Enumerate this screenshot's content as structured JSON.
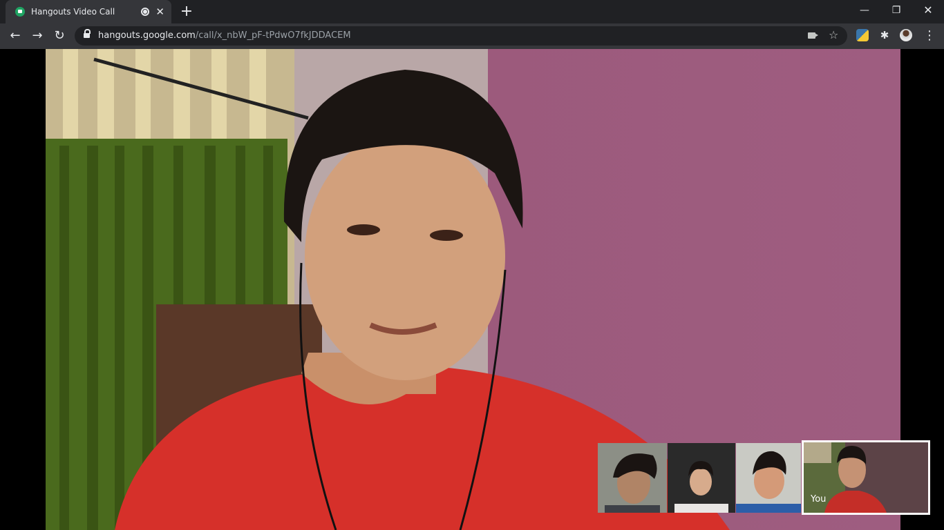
{
  "browser": {
    "tab": {
      "title": "Hangouts Video Call"
    },
    "address_bar": {
      "host": "hangouts.google.com",
      "path": "/call/x_nbW_pF-tPdwO7fkJDDACEM"
    }
  },
  "call": {
    "self_label": "You",
    "participants": [
      {
        "id": "participant-1",
        "muted": false
      },
      {
        "id": "participant-2",
        "muted": false
      },
      {
        "id": "participant-3",
        "muted": true
      },
      {
        "id": "you",
        "muted": false,
        "selected": true
      }
    ]
  },
  "colors": {
    "tab_strip": "#202124",
    "toolbar": "#35363a",
    "omnibox": "#202124",
    "wall": "#9c5a7c",
    "shirt": "#d6302a",
    "selected_border": "#ffffff"
  },
  "icons": {
    "favicon": "hangouts-icon",
    "record": "recording-icon",
    "close": "close-icon",
    "new_tab": "plus-icon",
    "back": "back-arrow-icon",
    "forward": "forward-arrow-icon",
    "reload": "reload-icon",
    "lock": "lock-icon",
    "camera": "camera-icon",
    "bookmark": "star-icon",
    "extension_python": "python-icon",
    "extensions": "puzzle-icon",
    "profile": "avatar",
    "menu": "kebab-menu-icon",
    "mic_muted": "mic-muted-icon"
  }
}
